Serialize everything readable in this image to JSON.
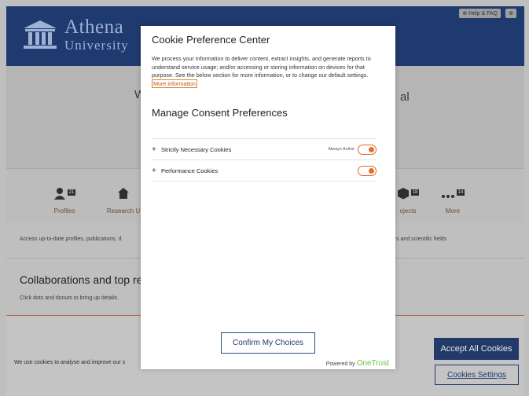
{
  "header": {
    "logo_line1": "Athena",
    "logo_line2": "University",
    "help_link": "⊕ Help & FAQ",
    "lang_link": "⊕"
  },
  "banner": {
    "title_left": "W",
    "title_right": "al"
  },
  "stats": [
    {
      "label": "Profiles",
      "count": "21",
      "icon": "person-icon"
    },
    {
      "label": "Research U",
      "count": "",
      "icon": "building-icon"
    },
    {
      "label": "ojects",
      "count": "18",
      "icon": "cube-icon"
    },
    {
      "label": "More",
      "count": "14",
      "icon": "dots-icon"
    }
  ],
  "access": {
    "text_left": "Access up-to-date profiles, publications, d",
    "text_right": "s and scientific fields"
  },
  "collab": {
    "heading": "Collaborations and top re",
    "subtext": "Click dots and donuts to bring up details."
  },
  "cookie_bar": {
    "message": "We use cookies to analyse and improve our s",
    "accept_label": "Accept All Cookies",
    "settings_label": "Cookies Settings"
  },
  "modal": {
    "title": "Cookie Preference Center",
    "description": "We process your information to deliver content, extract insights, and generate reports to understand service usage; and/or accessing or storing information on devices for that purpose. See the below section for more information, or to change our default settings.",
    "more_link": "More information",
    "manage_title": "Manage Consent Preferences",
    "categories": [
      {
        "label": "Strictly Necessary Cookies",
        "always_active": "Always Active"
      },
      {
        "label": "Performance Cookies"
      }
    ],
    "confirm_label": "Confirm My Choices",
    "powered_by": "Powered by",
    "brand": "OneTrust"
  },
  "colors": {
    "brand_navy": "#1f3a6e",
    "toggle_orange": "#e0702e",
    "onetrust_green": "#6cc04a"
  }
}
